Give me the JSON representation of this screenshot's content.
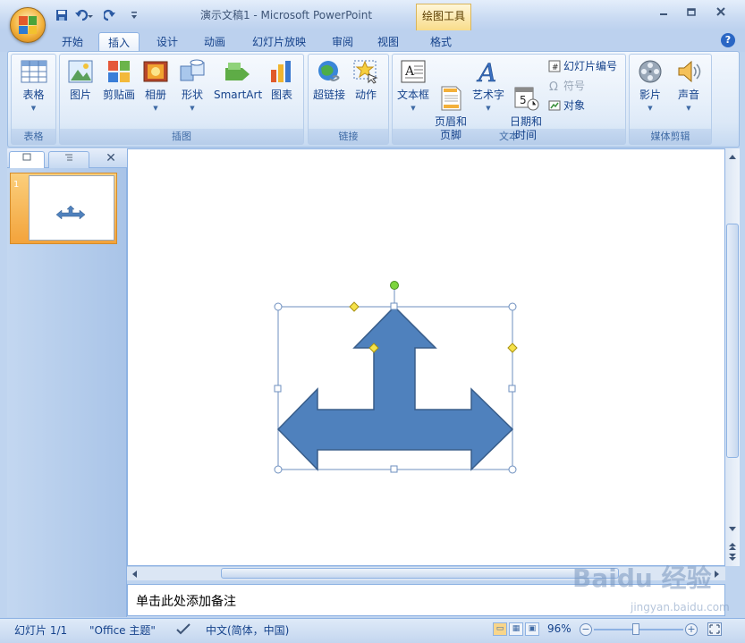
{
  "title_bar": {
    "document_title": "演示文稿1 - Microsoft PowerPoint",
    "context_tab_group": "绘图工具",
    "qat_icons": [
      "save-icon",
      "undo-icon",
      "redo-icon",
      "customize-icon"
    ],
    "window_controls": [
      "minimize",
      "maximize",
      "close"
    ]
  },
  "tabs": [
    {
      "label": "开始"
    },
    {
      "label": "插入",
      "active": true
    },
    {
      "label": "设计"
    },
    {
      "label": "动画"
    },
    {
      "label": "幻灯片放映"
    },
    {
      "label": "审阅"
    },
    {
      "label": "视图"
    },
    {
      "label": "格式"
    }
  ],
  "ribbon": {
    "groups": {
      "table": {
        "label": "表格",
        "buttons": [
          "表格"
        ]
      },
      "illustrations": {
        "label": "插图",
        "buttons": [
          "图片",
          "剪贴画",
          "相册",
          "形状",
          "SmartArt",
          "图表"
        ]
      },
      "links": {
        "label": "链接",
        "buttons": [
          "超链接",
          "动作"
        ]
      },
      "text": {
        "label": "文本",
        "buttons": [
          "文本框",
          "页眉和\n页脚",
          "艺术字",
          "日期和\n时间"
        ],
        "small_buttons": [
          "幻灯片编号",
          "符号",
          "对象"
        ]
      },
      "media": {
        "label": "媒体剪辑",
        "buttons": [
          "影片",
          "声音"
        ]
      }
    }
  },
  "slide_panel": {
    "tabs": [
      "slides-tab",
      "outline-tab"
    ],
    "slide_number": "1"
  },
  "notes": {
    "placeholder": "单击此处添加备注"
  },
  "status_bar": {
    "slide_info": "幻灯片 1/1",
    "theme": "\"Office 主题\"",
    "language": "中文(简体，中国)",
    "zoom": "96%"
  },
  "watermark": {
    "text": "Baidu 经验",
    "url": "jingyan.baidu.com"
  },
  "colors": {
    "shape_fill": "#4f81bd",
    "shape_stroke": "#385d8a",
    "ribbon_text": "#15428b",
    "selected_thumb": "#f6b04d"
  }
}
